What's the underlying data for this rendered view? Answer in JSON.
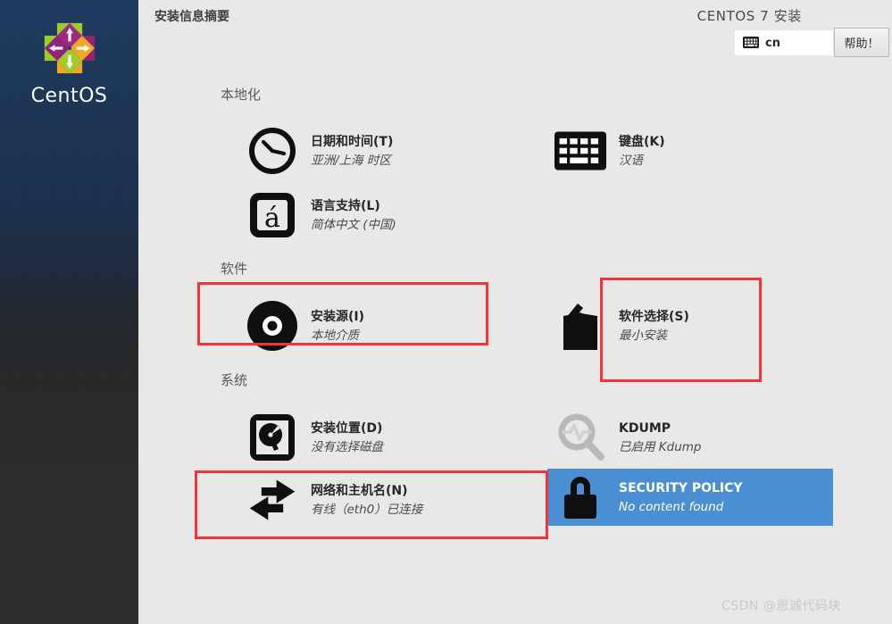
{
  "window": {
    "page_title": "安装信息摘要",
    "brand_title": "CENTOS 7 安装",
    "help_label": "帮助！",
    "keyboard_layout": "cn",
    "keyboard_icon": "keyboard-icon",
    "watermark": "CSDN @恩诚代码块"
  },
  "sidebar": {
    "logo_text": "CentOS",
    "logo_icon": "centos-logo-icon"
  },
  "colors": {
    "selection_blue": "#4a8fd4",
    "annotation_red": "#f8303a",
    "background": "#e8e8e6",
    "sidebar_top": "#1e3a5f",
    "sidebar_bottom": "#2c2c2c"
  },
  "sections": [
    {
      "id": "localization",
      "title": "本地化",
      "items": [
        {
          "id": "date-time",
          "icon": "clock-icon",
          "title": "日期和时间(T)",
          "sub": "亚洲/上海 时区",
          "selected": false,
          "annotated": false
        },
        {
          "id": "keyboard",
          "icon": "keyboard-icon",
          "title": "键盘(K)",
          "sub": "汉语",
          "selected": false,
          "annotated": false
        },
        {
          "id": "language-support",
          "icon": "language-icon",
          "title": "语言支持(L)",
          "sub": "简体中文 (中国)",
          "selected": false,
          "annotated": false
        }
      ]
    },
    {
      "id": "software",
      "title": "软件",
      "items": [
        {
          "id": "installation-source",
          "icon": "disc-icon",
          "title": "安装源(I)",
          "sub": "本地介质",
          "selected": false,
          "annotated": true
        },
        {
          "id": "software-selection",
          "icon": "package-icon",
          "title": "软件选择(S)",
          "sub": "最小安装",
          "selected": false,
          "annotated": true
        }
      ]
    },
    {
      "id": "system",
      "title": "系统",
      "items": [
        {
          "id": "installation-destination",
          "icon": "harddisk-icon",
          "title": "安装位置(D)",
          "sub": "没有选择磁盘",
          "selected": false,
          "annotated": false
        },
        {
          "id": "kdump",
          "icon": "magnifier-icon",
          "title": "KDUMP",
          "sub": "已启用 Kdump",
          "selected": false,
          "annotated": false
        },
        {
          "id": "network-hostname",
          "icon": "network-arrows-icon",
          "title": "网络和主机名(N)",
          "sub": "有线（eth0）已连接",
          "selected": false,
          "annotated": true
        },
        {
          "id": "security-policy",
          "icon": "lock-icon",
          "title": "SECURITY POLICY",
          "sub": "No content found",
          "selected": true,
          "annotated": false
        }
      ]
    }
  ]
}
